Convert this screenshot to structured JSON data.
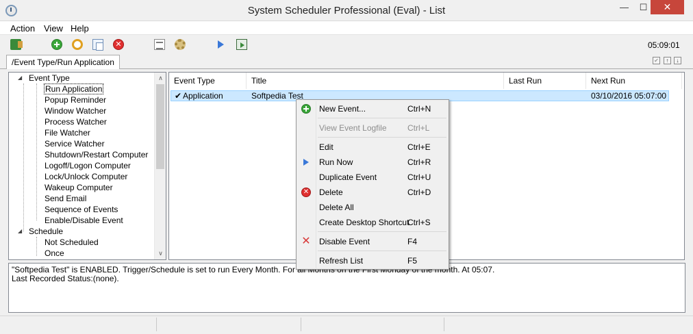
{
  "window": {
    "title": "System Scheduler Professional (Eval) - List",
    "minimize_glyph": "—",
    "maximize_glyph": "☐",
    "close_glyph": "✕"
  },
  "menu": [
    "Action",
    "View",
    "Help"
  ],
  "toolbar": {
    "icons": [
      "exit-icon",
      "new-event-icon",
      "edit-event-icon",
      "duplicate-icon",
      "delete-icon",
      "view-logfile-icon",
      "settings-gear-icon",
      "run-now-icon",
      "export-icon"
    ],
    "clock": "05:09:01"
  },
  "tab": {
    "label": "/Event Type/Run Application",
    "check_glyph": "✔",
    "up_glyph": "↑",
    "down_glyph": "↓"
  },
  "tree": {
    "event_type_label": "Event Type",
    "event_types": [
      "Run Application",
      "Popup Reminder",
      "Window Watcher",
      "Process Watcher",
      "File Watcher",
      "Service Watcher",
      "Shutdown/Restart Computer",
      "Logoff/Logon Computer",
      "Lock/Unlock Computer",
      "Wakeup Computer",
      "Send Email",
      "Sequence of Events",
      "Enable/Disable Event"
    ],
    "schedule_label": "Schedule",
    "schedules": [
      "Not Scheduled",
      "Once"
    ],
    "expand_glyph": "◢",
    "scroll_up_glyph": "∧",
    "scroll_down_glyph": "∨"
  },
  "list": {
    "columns": [
      "Event Type",
      "Title",
      "Last Run",
      "Next Run"
    ],
    "rows": [
      {
        "check": "✔",
        "event_type": "Application",
        "title": "Softpedia Test",
        "last_run": "",
        "next_run": "03/10/2016 05:07:00"
      }
    ]
  },
  "context_menu": {
    "items": [
      {
        "label": "New Event...",
        "shortcut": "Ctrl+N",
        "icon": "add-icon",
        "disabled": false
      },
      {
        "label": "View Event Logfile",
        "shortcut": "Ctrl+L",
        "icon": "",
        "disabled": true
      },
      {
        "label": "Edit",
        "shortcut": "Ctrl+E",
        "icon": "",
        "disabled": false
      },
      {
        "label": "Run Now",
        "shortcut": "Ctrl+R",
        "icon": "play-icon",
        "disabled": false
      },
      {
        "label": "Duplicate Event",
        "shortcut": "Ctrl+U",
        "icon": "",
        "disabled": false
      },
      {
        "label": "Delete",
        "shortcut": "Ctrl+D",
        "icon": "delete-icon",
        "disabled": false
      },
      {
        "label": "Delete All",
        "shortcut": "",
        "icon": "",
        "disabled": false
      },
      {
        "label": "Create Desktop Shortcut",
        "shortcut": "Ctrl+S",
        "icon": "",
        "disabled": false
      },
      {
        "label": "Disable Event",
        "shortcut": "F4",
        "icon": "x-icon",
        "disabled": false
      },
      {
        "label": "Refresh List",
        "shortcut": "F5",
        "icon": "",
        "disabled": false
      }
    ]
  },
  "status_text": {
    "line1": "\"Softpedia Test\" is ENABLED. Trigger/Schedule is set to run Every Month. For all Months on the First Monday of the month. At 05:07.",
    "line2": "Last Recorded Status:(none)."
  }
}
